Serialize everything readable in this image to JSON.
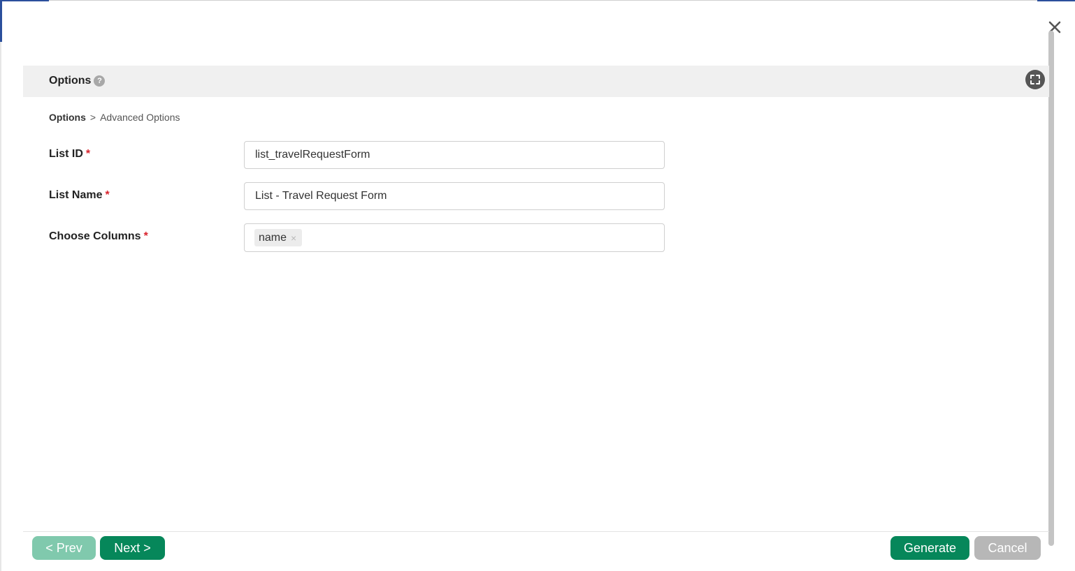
{
  "dialog": {
    "header": {
      "title": "Options",
      "help_glyph": "?"
    },
    "breadcrumb": {
      "root": "Options",
      "separator": ">",
      "current": "Advanced Options"
    },
    "fields": {
      "list_id": {
        "label": "List ID",
        "required_mark": "*",
        "value": "list_travelRequestForm"
      },
      "list_name": {
        "label": "List Name",
        "required_mark": "*",
        "value": "List - Travel Request Form"
      },
      "choose_columns": {
        "label": "Choose Columns",
        "required_mark": "*",
        "selected": [
          "name"
        ],
        "remove_glyph": "×"
      }
    },
    "footer": {
      "prev_label": "< Prev",
      "next_label": "Next >",
      "generate_label": "Generate",
      "cancel_label": "Cancel"
    }
  },
  "colors": {
    "primary": "#06875a",
    "primary_disabled": "#80c9ad",
    "cancel": "#b7b7b7",
    "required": "#d9232d",
    "header_bg": "#f0f0f0"
  },
  "icons": {
    "close": "close-icon",
    "help": "help-icon",
    "fullscreen": "fullscreen-icon",
    "chip_remove": "close-icon"
  }
}
